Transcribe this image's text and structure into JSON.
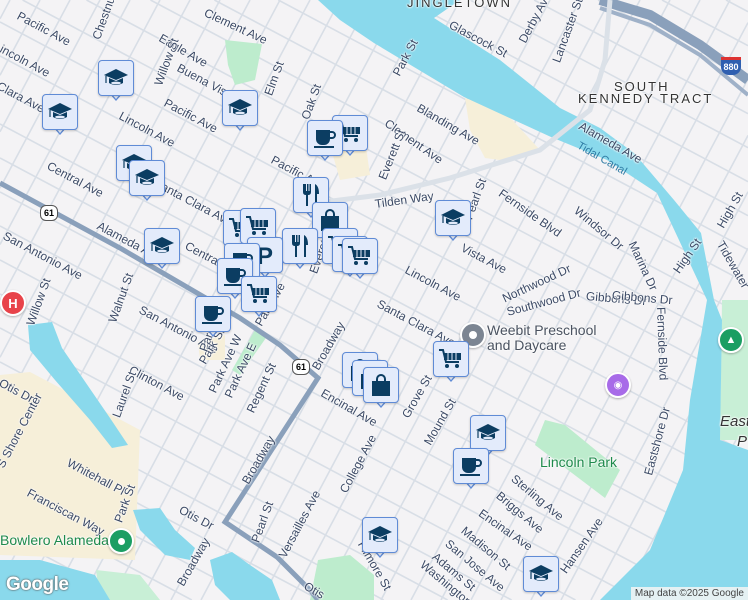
{
  "map": {
    "attribution": "Map data ©2025 Google",
    "logo": "Google",
    "highway_shields": {
      "route_61": "61",
      "interstate_880": "880"
    },
    "colors": {
      "water": "#8ad9ec",
      "land": "#f4f3f5",
      "park": "#bdeccd",
      "beige": "#f6efd9",
      "road": "#d6dde6",
      "highway": "#8aa0bb",
      "marker_bg": "#e3ebfb",
      "marker_border": "#5f8bd6",
      "icon": "#0b3d62"
    }
  },
  "labels": [
    {
      "text": "Pacific Ave"
    },
    {
      "text": "Chestnut"
    },
    {
      "text": "Eagle Ave"
    },
    {
      "text": "Clement Ave"
    },
    {
      "text": "Lincoln Ave"
    },
    {
      "text": "Buena Vista"
    },
    {
      "text": "Willow St"
    },
    {
      "text": "Elm St"
    },
    {
      "text": "Pacific Ave"
    },
    {
      "text": "Lincoln Ave"
    },
    {
      "text": "Oak St"
    },
    {
      "text": "Clara Ave"
    },
    {
      "text": "Pacific Ave"
    },
    {
      "text": "Central Ave"
    },
    {
      "text": "Santa Clara Ave"
    },
    {
      "text": "Alameda Ave"
    },
    {
      "text": "Central Ave"
    },
    {
      "text": "San Antonio Ave"
    },
    {
      "text": "Willow St"
    },
    {
      "text": "Walnut St"
    },
    {
      "text": "San Antonio Ave"
    },
    {
      "text": "Park Ave"
    },
    {
      "text": "Park St"
    },
    {
      "text": "Clinton Ave"
    },
    {
      "text": "Laurel St"
    },
    {
      "text": "Park Ave W"
    },
    {
      "text": "Park Ave E"
    },
    {
      "text": "Regent St"
    },
    {
      "text": "Broadway"
    },
    {
      "text": "Otis Dr"
    },
    {
      "text": "S Shore Center"
    },
    {
      "text": "Whitehall Pl"
    },
    {
      "text": "Franciscan Way"
    },
    {
      "text": "Park St"
    },
    {
      "text": "Otis Dr"
    },
    {
      "text": "Broadway"
    },
    {
      "text": "Broadway"
    },
    {
      "text": "Pearl St"
    },
    {
      "text": "Versailles Ave"
    },
    {
      "text": "College Ave"
    },
    {
      "text": "Encinal Ave"
    },
    {
      "text": "Filmore St"
    },
    {
      "text": "Otis"
    },
    {
      "text": "JINGLETOWN"
    },
    {
      "text": "Glascock St"
    },
    {
      "text": "Derby Ave"
    },
    {
      "text": "Lancaster St"
    },
    {
      "text": "Park St"
    },
    {
      "text": "Blanding Ave"
    },
    {
      "text": "Clement Ave"
    },
    {
      "text": "Everett St"
    },
    {
      "text": "Tilden Way"
    },
    {
      "text": "Pearl St"
    },
    {
      "text": "Fernside Blvd"
    },
    {
      "text": "Windsor Dr"
    },
    {
      "text": "Marina Dr"
    },
    {
      "text": "SOUTH"
    },
    {
      "text": "KENNEDY TRACT"
    },
    {
      "text": "Alameda Ave"
    },
    {
      "text": "Tidal Canal"
    },
    {
      "text": "High St"
    },
    {
      "text": "High St"
    },
    {
      "text": "Tidewater"
    },
    {
      "text": "Vista Ave"
    },
    {
      "text": "Lincoln Ave"
    },
    {
      "text": "Northwood Dr"
    },
    {
      "text": "Gibbons Dr"
    },
    {
      "text": "Southwood Dr"
    },
    {
      "text": "Santa Clara Ave"
    },
    {
      "text": "Grove St"
    },
    {
      "text": "Mound St"
    },
    {
      "text": "Sterling Ave"
    },
    {
      "text": "Briggs Ave"
    },
    {
      "text": "Lincoln Park"
    },
    {
      "text": "Encinal Ave"
    },
    {
      "text": "Madison St"
    },
    {
      "text": "San Jose Ave"
    },
    {
      "text": "Adams St"
    },
    {
      "text": "Washington"
    },
    {
      "text": "Hansen Ave"
    },
    {
      "text": "Eastshore Dr"
    },
    {
      "text": "Fernside Blvd"
    },
    {
      "text": "East"
    },
    {
      "text": "P"
    },
    {
      "text": "Everett"
    },
    {
      "text": "Park"
    },
    {
      "text": "Bowlero Alameda"
    },
    {
      "text": "Weebit Preschool"
    },
    {
      "text": "and Daycare"
    },
    {
      "text": "Gibbons Dr"
    }
  ],
  "marker_icons": {
    "school": "graduation-cap-icon",
    "coffee": "coffee-cup-icon",
    "grocery": "shopping-cart-icon",
    "restaurant": "fork-knife-icon",
    "shopping": "shopping-bag-icon",
    "parking": "parking-icon"
  }
}
